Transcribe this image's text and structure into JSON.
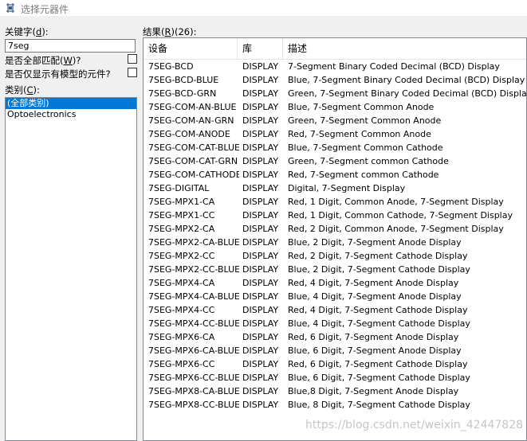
{
  "window": {
    "title": "选择元器件"
  },
  "keyword": {
    "label_pre": "关键字(",
    "label_key": "d",
    "label_post": "):",
    "value": "7seg"
  },
  "options": {
    "match_all": {
      "label_pre": "是否全部匹配(",
      "label_key": "W",
      "label_post": ")?",
      "checked": false
    },
    "model_only": {
      "label": "是否仅显示有模型的元件?",
      "checked": false
    }
  },
  "category": {
    "label_pre": "类别(",
    "label_key": "C",
    "label_post": "):",
    "items": [
      {
        "label": "(全部类别)",
        "selected": true
      },
      {
        "label": "Optoelectronics",
        "selected": false
      }
    ]
  },
  "results": {
    "label_pre": "结果(",
    "label_key": "R",
    "label_post": ")(26):",
    "columns": [
      "设备",
      "库",
      "描述"
    ],
    "rows": [
      [
        "7SEG-BCD",
        "DISPLAY",
        "7-Segment Binary Coded Decimal (BCD) Display"
      ],
      [
        "7SEG-BCD-BLUE",
        "DISPLAY",
        "Blue,  7-Segment Binary Coded Decimal (BCD) Display"
      ],
      [
        "7SEG-BCD-GRN",
        "DISPLAY",
        "Green, 7-Segment Binary Coded Decimal (BCD) Display"
      ],
      [
        "7SEG-COM-AN-BLUE",
        "DISPLAY",
        "Blue, 7-Segment Common Anode"
      ],
      [
        "7SEG-COM-AN-GRN",
        "DISPLAY",
        "Green, 7-Segment Common Anode"
      ],
      [
        "7SEG-COM-ANODE",
        "DISPLAY",
        "Red, 7-Segment Common Anode"
      ],
      [
        "7SEG-COM-CAT-BLUE",
        "DISPLAY",
        "Blue, 7-Segment Common Cathode"
      ],
      [
        "7SEG-COM-CAT-GRN",
        "DISPLAY",
        "Green, 7-Segment common Cathode"
      ],
      [
        "7SEG-COM-CATHODE",
        "DISPLAY",
        "Red, 7-Segment common Cathode"
      ],
      [
        "7SEG-DIGITAL",
        "DISPLAY",
        "Digital, 7-Segment Display"
      ],
      [
        "7SEG-MPX1-CA",
        "DISPLAY",
        "Red, 1 Digit, Common Anode, 7-Segment Display"
      ],
      [
        "7SEG-MPX1-CC",
        "DISPLAY",
        "Red, 1 Digit, Common Cathode, 7-Segment Display"
      ],
      [
        "7SEG-MPX2-CA",
        "DISPLAY",
        "Red, 2 Digit, Common Anode, 7-Segment Display"
      ],
      [
        "7SEG-MPX2-CA-BLUE",
        "DISPLAY",
        "Blue, 2 Digit, 7-Segment Anode Display"
      ],
      [
        "7SEG-MPX2-CC",
        "DISPLAY",
        "Red, 2 Digit, 7-Segment Cathode Display"
      ],
      [
        "7SEG-MPX2-CC-BLUE",
        "DISPLAY",
        "Blue, 2 Digit, 7-Segment Cathode Display"
      ],
      [
        "7SEG-MPX4-CA",
        "DISPLAY",
        "Red, 4 Digit, 7-Segment Anode Display"
      ],
      [
        "7SEG-MPX4-CA-BLUE",
        "DISPLAY",
        "Blue, 4 Digit, 7-Segment Anode Display"
      ],
      [
        "7SEG-MPX4-CC",
        "DISPLAY",
        "Red, 4 Digit, 7-Segment Cathode Display"
      ],
      [
        "7SEG-MPX4-CC-BLUE",
        "DISPLAY",
        "Blue, 4 Digit, 7-Segment Cathode Display"
      ],
      [
        "7SEG-MPX6-CA",
        "DISPLAY",
        "Red, 6 Digit, 7-Segment Anode Display"
      ],
      [
        "7SEG-MPX6-CA-BLUE",
        "DISPLAY",
        "Blue, 6 Digit, 7-Segment Anode Display"
      ],
      [
        "7SEG-MPX6-CC",
        "DISPLAY",
        "Red, 6 Digit, 7-Segment Cathode Display"
      ],
      [
        "7SEG-MPX6-CC-BLUE",
        "DISPLAY",
        "Blue, 6 Digit, 7-Segment Cathode Display"
      ],
      [
        "7SEG-MPX8-CA-BLUE",
        "DISPLAY",
        "Blue,8 Digit, 7-Segment Anode Display"
      ],
      [
        "7SEG-MPX8-CC-BLUE",
        "DISPLAY",
        "Blue, 8 Digit, 7-Segment Cathode Display"
      ]
    ]
  },
  "watermark": "https://blog.csdn.net/weixin_42447828",
  "colors": {
    "selection": "#0078d7",
    "title_text": "#7a7a7a"
  },
  "icons": {
    "title": "component-pick-icon"
  }
}
